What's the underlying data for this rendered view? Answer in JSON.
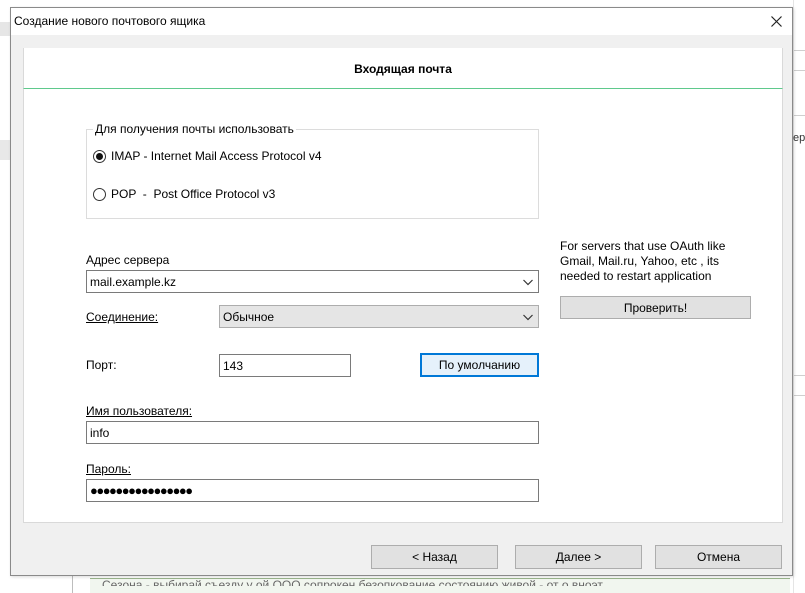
{
  "dialog": {
    "title": "Создание нового почтового ящика",
    "close_icon": "close-icon"
  },
  "header": {
    "title": "Входящая почта"
  },
  "receive_group": {
    "legend": "Для получения почты использовать",
    "options": [
      {
        "label": "IMAP - Internet Mail Access Protocol v4",
        "checked": true
      },
      {
        "label": "POP  -  Post Office Protocol v3",
        "checked": false
      }
    ]
  },
  "server": {
    "label": "Адрес сервера",
    "value": "mail.example.kz"
  },
  "connection": {
    "label": "Соединение:",
    "value": "Обычное"
  },
  "port": {
    "label": "Порт:",
    "value": "143",
    "default_button": "По умолчанию"
  },
  "username": {
    "label": "Имя пользователя:",
    "value": "info"
  },
  "password": {
    "label": "Пароль:",
    "value": "●●●●●●●●●●●●●●●●"
  },
  "oauth": {
    "note": "For servers that use OAuth like Gmail, Mail.ru, Yahoo, etc , its needed to restart application",
    "check_button": "Проверить!"
  },
  "footer": {
    "back": "< Назад",
    "next": "Далее >",
    "cancel": "Отмена"
  },
  "background": {
    "right_fragment": "ер",
    "bottom_fragment": "Сезона - выбирай съезду у ой ООО сопрокен безопкование состоянию живой - от о вноэт"
  }
}
